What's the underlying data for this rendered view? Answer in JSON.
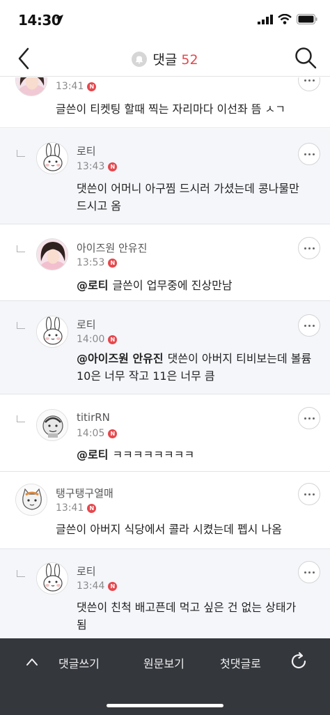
{
  "status": {
    "time": "14:30"
  },
  "header": {
    "title": "댓글",
    "count": "52"
  },
  "comments": [
    {
      "nick": "",
      "time": "13:41",
      "body": "글쓴이 티켓팅 할때 찍는 자리마다 이선좌 뜸 ㅅㄱ",
      "reply": false,
      "avatar": "girl-photo"
    },
    {
      "nick": "로티",
      "time": "13:43",
      "body": "댓쓴이 어머니 아구찜 드시러 가셨는데 콩나물만 드시고 옴",
      "reply": true,
      "avatar": "rabbit"
    },
    {
      "nick": "아이즈원 안유진",
      "time": "13:53",
      "mention": "@로티",
      "body": "글쓴이 업무중에 진상만남",
      "reply": true,
      "avatar": "girl-photo"
    },
    {
      "nick": "로티",
      "time": "14:00",
      "mention": "@아이즈원 안유진",
      "body": "댓쓴이 아버지 티비보는데 볼륨 10은 너무 작고 11은 너무 큼",
      "reply": true,
      "avatar": "rabbit"
    },
    {
      "nick": "titirRN",
      "time": "14:05",
      "mention": "@로티",
      "body": "ㅋㅋㅋㅋㅋㅋㅋㅋ",
      "reply": true,
      "avatar": "cartoon"
    },
    {
      "nick": "탱구탱구열매",
      "time": "13:41",
      "body": "글쓴이 아버지 식당에서 콜라 시켰는데 펩시 나옴",
      "reply": false,
      "avatar": "cat"
    },
    {
      "nick": "로티",
      "time": "13:44",
      "body": "댓쓴이 친척 배고픈데 먹고 싶은 건 없는 상태가 됨",
      "reply": true,
      "avatar": "rabbit"
    }
  ],
  "new_badge": "N",
  "bottom_bar": {
    "write": "댓글쓰기",
    "original": "원문보기",
    "first": "첫댓글로"
  },
  "colors": {
    "accent": "#e5484d",
    "reply_bg": "#f4f6fa",
    "bottom_bg": "#34373c"
  }
}
